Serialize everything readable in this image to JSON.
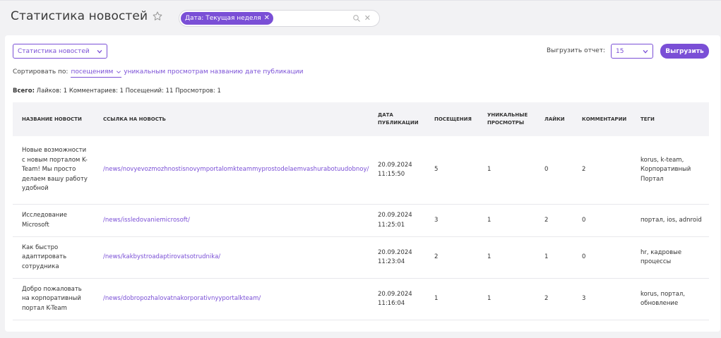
{
  "header": {
    "title": "Статистика новостей",
    "filter_chip": "Дата: Текущая неделя",
    "chip_close": "✕",
    "filter_clear": "✕"
  },
  "controls": {
    "report_select": "Статистика новостей",
    "export_label": "Выгрузить отчет:",
    "page_size": "15",
    "export_button": "Выгрузить"
  },
  "sort": {
    "label": "Сортировать по:",
    "active": "посещениям",
    "options": [
      "уникальным просмотрам",
      "названию",
      "дате публикации"
    ]
  },
  "totals": {
    "label": "Всего:",
    "text": "Лайков: 1 Комментариев: 1 Посещений: 11 Просмотров: 1"
  },
  "table": {
    "columns": [
      "Название новости",
      "Ссылка на новость",
      "Дата публикации",
      "Посещения",
      "Уникальные просмотры",
      "Лайки",
      "Комментарии",
      "Теги"
    ],
    "rows": [
      {
        "title": "Новые возможности с новым порталом K-Team! Мы просто делаем вашу работу удобной",
        "link": "/news/novyevozmozhnostisnovymportalomkteammyprostodelaemvashurabotuudobnoy/",
        "date": "20.09.2024",
        "time": "11:15:50",
        "visits": "5",
        "unique": "1",
        "likes": "0",
        "comments": "2",
        "tags": "korus, k-team, Корпоративный Портал"
      },
      {
        "title": "Исследование Microsoft",
        "link": "/news/issledovaniemicrosoft/",
        "date": "20.09.2024",
        "time": "11:25:01",
        "visits": "3",
        "unique": "1",
        "likes": "2",
        "comments": "0",
        "tags": "портал, ios, adnroid"
      },
      {
        "title": "Как быстро адаптировать сотрудника",
        "link": "/news/kakbystroadaptirovatsotrudnika/",
        "date": "20.09.2024",
        "time": "11:23:04",
        "visits": "2",
        "unique": "1",
        "likes": "1",
        "comments": "0",
        "tags": "hr, кадровые процессы"
      },
      {
        "title": "Добро пожаловать на корпоративный портал K-Team",
        "link": "/news/dobropozhalovatnakorporativnyyportalkteam/",
        "date": "20.09.2024",
        "time": "11:16:04",
        "visits": "1",
        "unique": "1",
        "likes": "2",
        "comments": "3",
        "tags": "korus, портал, обновление"
      }
    ]
  },
  "colors": {
    "accent": "#7a4fd6",
    "background": "#f2f2f4"
  },
  "icons": [
    "star-icon",
    "search-icon",
    "close-icon",
    "chevron-down-icon"
  ]
}
